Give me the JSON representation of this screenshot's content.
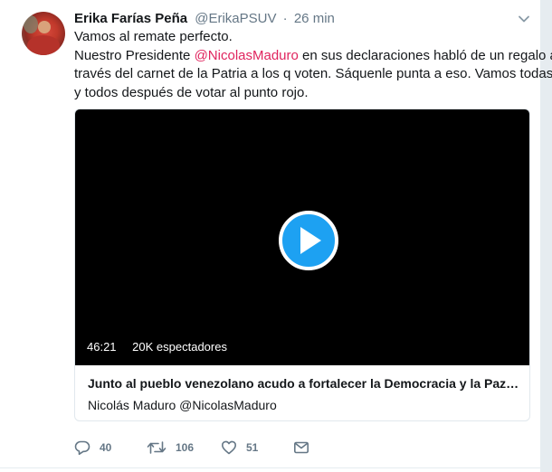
{
  "tweet": {
    "author_name": "Erika Farías Peña",
    "author_handle": "@ErikaPSUV",
    "separator": "·",
    "timestamp": "26 min",
    "text": {
      "line1": "Vamos al remate perfecto.",
      "line2_before": "Nuestro Presidente ",
      "line2_mention": "@NicolasMaduro",
      "line2_after": " en sus declaraciones habló de un regalo a",
      "line3": "través del carnet de la Patria a los q voten.  Sáquenle punta a eso.  Vamos todas",
      "line4": "y todos después de votar al punto rojo."
    },
    "mention_color": "#e0245e"
  },
  "card": {
    "duration": "46:21",
    "viewers": "20K espectadores",
    "title": "Junto al pueblo venezolano acudo a fortalecer la Democracia y la Paz…",
    "author": "Nicolás Maduro @NicolasMaduro",
    "play_color": "#1da1f2"
  },
  "actions": {
    "reply_count": "40",
    "retweet_count": "106",
    "like_count": "51"
  },
  "icons": [
    "avatar",
    "chevron-down-icon",
    "play-icon",
    "reply-icon",
    "retweet-icon",
    "like-icon",
    "direct-message-icon"
  ]
}
